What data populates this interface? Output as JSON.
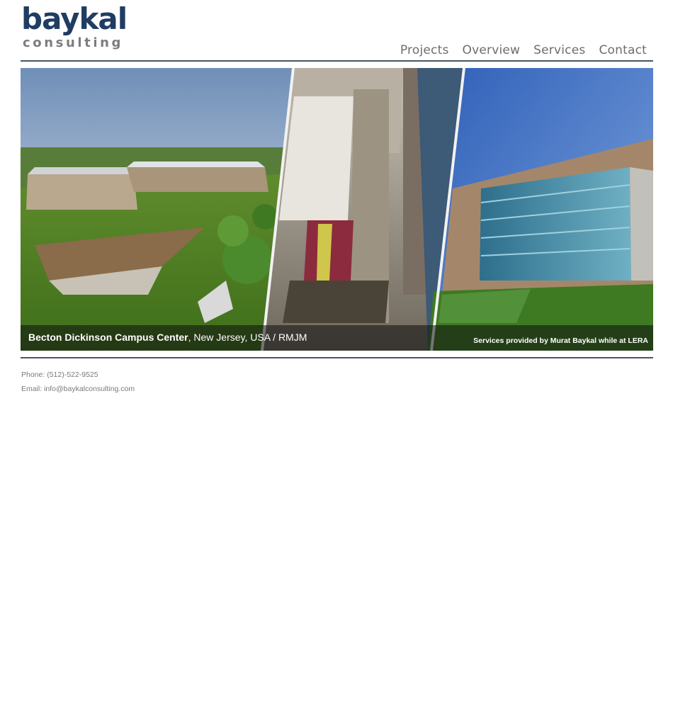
{
  "logo": {
    "main": "baykal",
    "sub": "consulting"
  },
  "nav": [
    {
      "label": "Projects"
    },
    {
      "label": "Overview"
    },
    {
      "label": "Services"
    },
    {
      "label": "Contact"
    }
  ],
  "hero": {
    "project_name": "Becton Dickinson Campus Center",
    "project_location": ", New Jersey, USA  /  RMJM",
    "credit": "Services provided by Murat Baykal while at LERA"
  },
  "contact": {
    "phone_label": "Phone: ",
    "phone": "(512)-522-9525",
    "email_label": "Email: ",
    "email": "info@baykalconsulting.com"
  },
  "colors": {
    "brand": "#1f3d63",
    "logo_sub": "#7d7d7d",
    "nav_text": "#6d6d6d",
    "rule": "#4a5566"
  }
}
